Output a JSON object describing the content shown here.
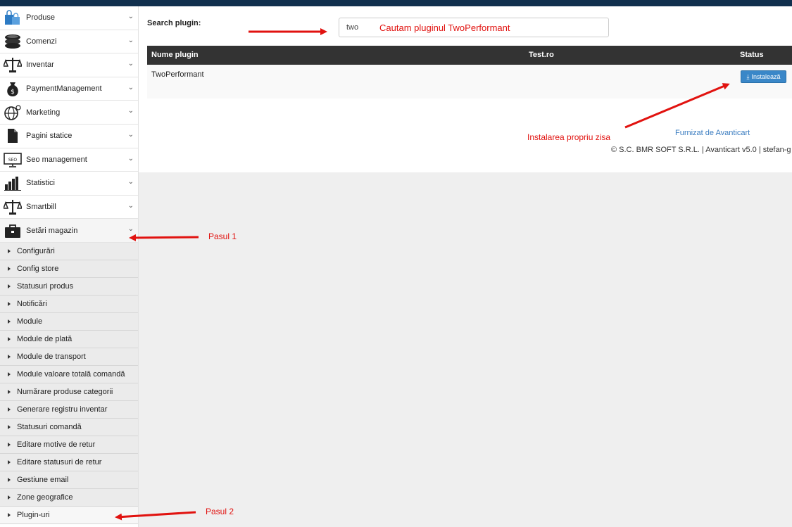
{
  "sidebar": {
    "items": [
      {
        "label": "Produse",
        "icon": "shopping-bags-icon"
      },
      {
        "label": "Comenzi",
        "icon": "coins-icon"
      },
      {
        "label": "Inventar",
        "icon": "scale-icon"
      },
      {
        "label": "PaymentManagement",
        "icon": "money-bag-icon"
      },
      {
        "label": "Marketing",
        "icon": "globe-icon"
      },
      {
        "label": "Pagini statice",
        "icon": "document-icon"
      },
      {
        "label": "Seo management",
        "icon": "seo-monitor-icon"
      },
      {
        "label": "Statistici",
        "icon": "bar-chart-icon"
      },
      {
        "label": "Smartbill",
        "icon": "scale-icon"
      },
      {
        "label": "Setări magazin",
        "icon": "briefcase-icon"
      }
    ],
    "submenu": [
      "Configurări",
      "Config store",
      "Statusuri produs",
      "Notificări",
      "Module",
      "Module de plată",
      "Module de transport",
      "Module valoare totală comandă",
      "Numărare produse categorii",
      "Generare registru inventar",
      "Statusuri comandă",
      "Editare motive de retur",
      "Editare statusuri de retur",
      "Gestiune email",
      "Zone geografice",
      "Plugin-uri"
    ]
  },
  "search": {
    "label": "Search plugin:",
    "value": "two"
  },
  "table": {
    "headers": [
      "Nume plugin",
      "Test.ro",
      "Status"
    ],
    "rows": [
      {
        "name": "TwoPerformant",
        "action": "Instalează"
      }
    ]
  },
  "footer": {
    "link": "Furnizat de Avanticart",
    "copyright": "© S.C. BMR SOFT S.R.L. | Avanticart v5.0 | stefan-g"
  },
  "annotations": {
    "search_note": "Cautam pluginul TwoPerformant",
    "install_note": "Instalarea propriu zisa",
    "step1": "Pasul 1",
    "step2": "Pasul 2"
  },
  "colors": {
    "topbar": "#11304e",
    "table_header": "#333333",
    "button": "#3a87c8",
    "link": "#3a7cc0",
    "annotation": "#e1120f"
  }
}
